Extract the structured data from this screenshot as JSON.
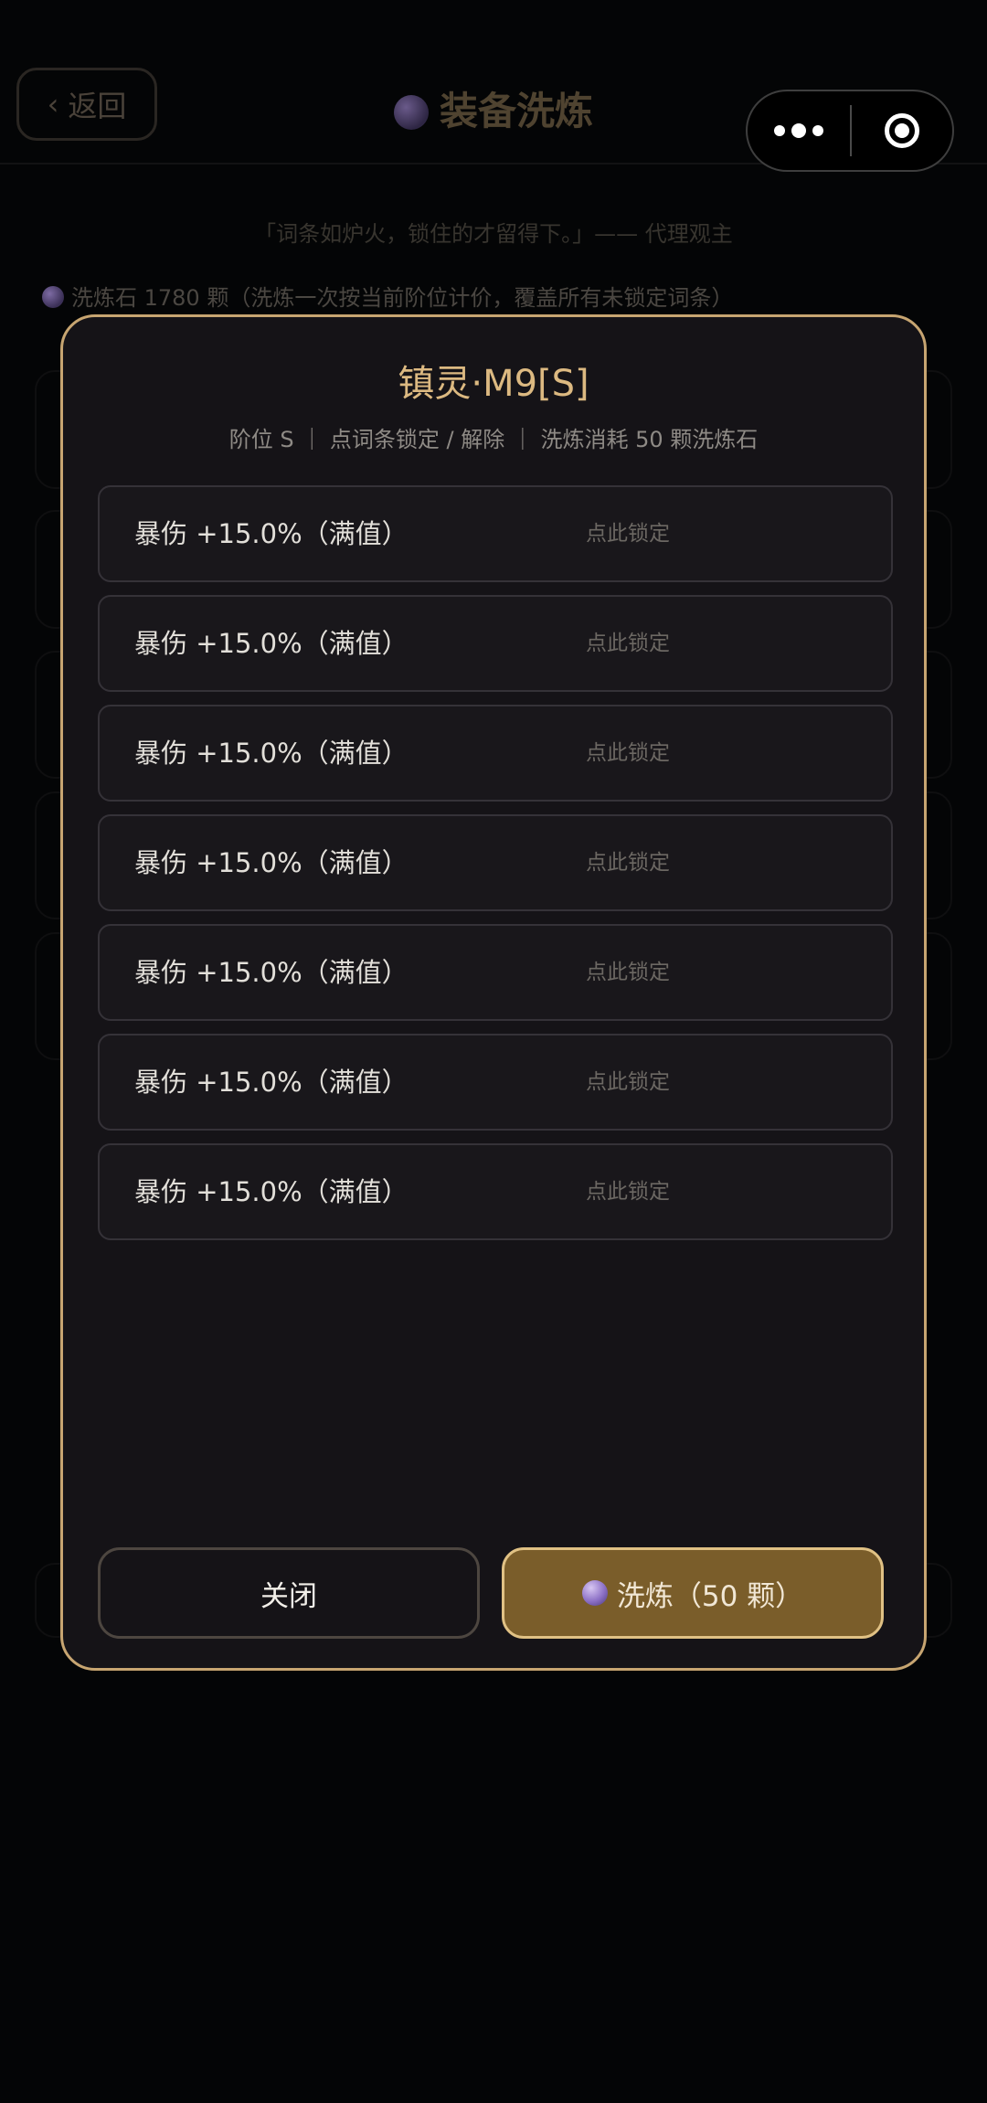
{
  "background": {
    "back_label": "返回",
    "title": "装备洗炼",
    "quote": "「词条如炉火，锁住的才留得下。」—— 代理观主",
    "stone_info": "洗炼石 1780 颗（洗炼一次按当前阶位计价，覆盖所有未锁定词条）"
  },
  "modal": {
    "title": "镇灵·M9[S]",
    "subtitle": "阶位 S ｜ 点词条锁定 / 解除 ｜ 洗炼消耗 50 颗洗炼石",
    "affixes": [
      {
        "text": "暴伤 +15.0%（满值）",
        "lock": "点此锁定"
      },
      {
        "text": "暴伤 +15.0%（满值）",
        "lock": "点此锁定"
      },
      {
        "text": "暴伤 +15.0%（满值）",
        "lock": "点此锁定"
      },
      {
        "text": "暴伤 +15.0%（满值）",
        "lock": "点此锁定"
      },
      {
        "text": "暴伤 +15.0%（满值）",
        "lock": "点此锁定"
      },
      {
        "text": "暴伤 +15.0%（满值）",
        "lock": "点此锁定"
      },
      {
        "text": "暴伤 +15.0%（满值）",
        "lock": "点此锁定"
      }
    ],
    "close_label": "关闭",
    "refine_label": "洗炼（50 颗）"
  },
  "colors": {
    "accent_gold": "#c7a571",
    "button_gold": "#7a5d2a",
    "background": "#040506"
  },
  "icons": {
    "back": "chevron-left-icon",
    "refine_stone": "crystal-orb-icon",
    "capsule_more": "more-dots-icon",
    "capsule_close": "target-circle-icon"
  }
}
